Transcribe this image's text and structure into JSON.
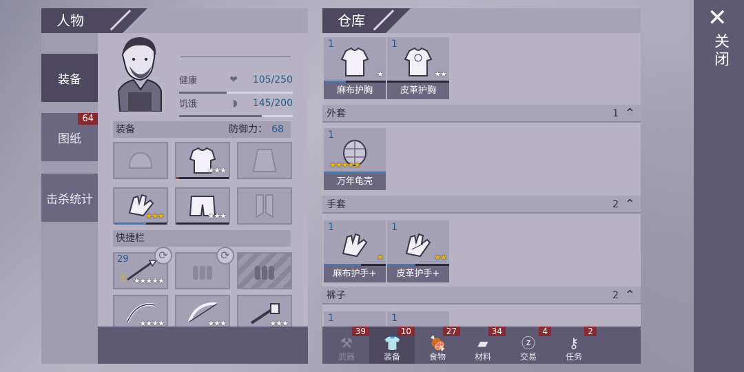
{
  "character": {
    "title": "人物",
    "side_tabs": [
      {
        "label": "装备"
      },
      {
        "label": "图纸",
        "badge": "64"
      },
      {
        "label": "击杀统计"
      }
    ],
    "stats": [
      {
        "label": "健康",
        "value": "105/250",
        "fraction": 0.42,
        "icon": "heart-icon"
      },
      {
        "label": "饥饿",
        "value": "145/200",
        "fraction": 0.725,
        "icon": "stomach-icon"
      }
    ],
    "equipment": {
      "label": "装备",
      "defense_label": "防御力：",
      "defense_value": "68"
    },
    "equip_slots": [
      {
        "item": "hat-outline-icon",
        "stars": 0,
        "durability": 0
      },
      {
        "item": "vest-icon",
        "stars": 3,
        "durability": 0.05
      },
      {
        "item": "coat-outline-icon",
        "stars": 0,
        "durability": 0
      },
      {
        "item": "gloves-icon",
        "stars": 3,
        "durability": 0.6
      },
      {
        "item": "shorts-icon",
        "stars": 3,
        "durability": 1.0
      },
      {
        "item": "boots-outline-icon",
        "stars": 0,
        "durability": 0
      }
    ],
    "quickbar": {
      "label": "快捷栏"
    },
    "quick_slots": [
      {
        "item": "spear-icon",
        "count": "29",
        "stars": 5,
        "warning": true,
        "refresh": true
      },
      {
        "item": "ammo-outline-icon",
        "refresh": true
      },
      {
        "item": "ammo-locked-icon",
        "locked": true
      },
      {
        "item": "bow-icon",
        "stars": 4,
        "durability": 0.9
      },
      {
        "item": "crossbow-icon",
        "stars": 3,
        "durability": 0.4
      },
      {
        "item": "wrench-icon",
        "stars": 3,
        "durability": 0.7
      }
    ]
  },
  "warehouse": {
    "title": "仓库",
    "top_items": [
      {
        "qty": "1",
        "name": "麻布护胸",
        "stars": 1,
        "durability": 0.35
      },
      {
        "qty": "1",
        "name": "皮革护胸",
        "stars": 2,
        "durability": 0.5
      }
    ],
    "categories": [
      {
        "label": "外套",
        "count": "1",
        "items": [
          {
            "qty": "1",
            "name": "万年龟壳",
            "stars": 5,
            "durability": 1.0
          }
        ]
      },
      {
        "label": "手套",
        "count": "2",
        "items": [
          {
            "qty": "1",
            "name": "麻布护手+",
            "stars": 1,
            "durability": 0.6
          },
          {
            "qty": "1",
            "name": "皮革护手+",
            "stars": 2,
            "durability": 0.45
          }
        ]
      },
      {
        "label": "裤子",
        "count": "2",
        "items": [
          {
            "qty": "1"
          },
          {
            "qty": "1"
          }
        ]
      }
    ],
    "tabs": [
      {
        "label": "武器",
        "badge": "39",
        "icon": "axe-icon"
      },
      {
        "label": "装备",
        "badge": "10",
        "icon": "shirt-icon"
      },
      {
        "label": "食物",
        "badge": "27",
        "icon": "meat-icon"
      },
      {
        "label": "材料",
        "badge": "34",
        "icon": "wood-icon"
      },
      {
        "label": "交易",
        "badge": "4",
        "icon": "coin-icon"
      },
      {
        "label": "任务",
        "badge": "2",
        "icon": "key-icon"
      }
    ]
  },
  "close": {
    "label": "关闭",
    "icon": "close-x-icon"
  }
}
